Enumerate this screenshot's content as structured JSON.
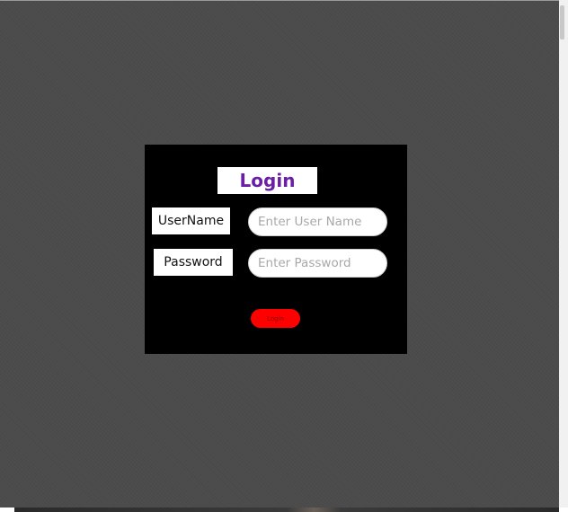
{
  "login": {
    "title": "Login",
    "username_label": "UserName",
    "username_placeholder": "Enter User Name",
    "username_value": "",
    "password_label": "Password",
    "password_placeholder": "Enter Password",
    "password_value": "",
    "button_label": "Login"
  },
  "colors": {
    "background": "#4d4d4d",
    "panel": "#000000",
    "title_text": "#6a1fa6",
    "button": "#ff0000"
  }
}
